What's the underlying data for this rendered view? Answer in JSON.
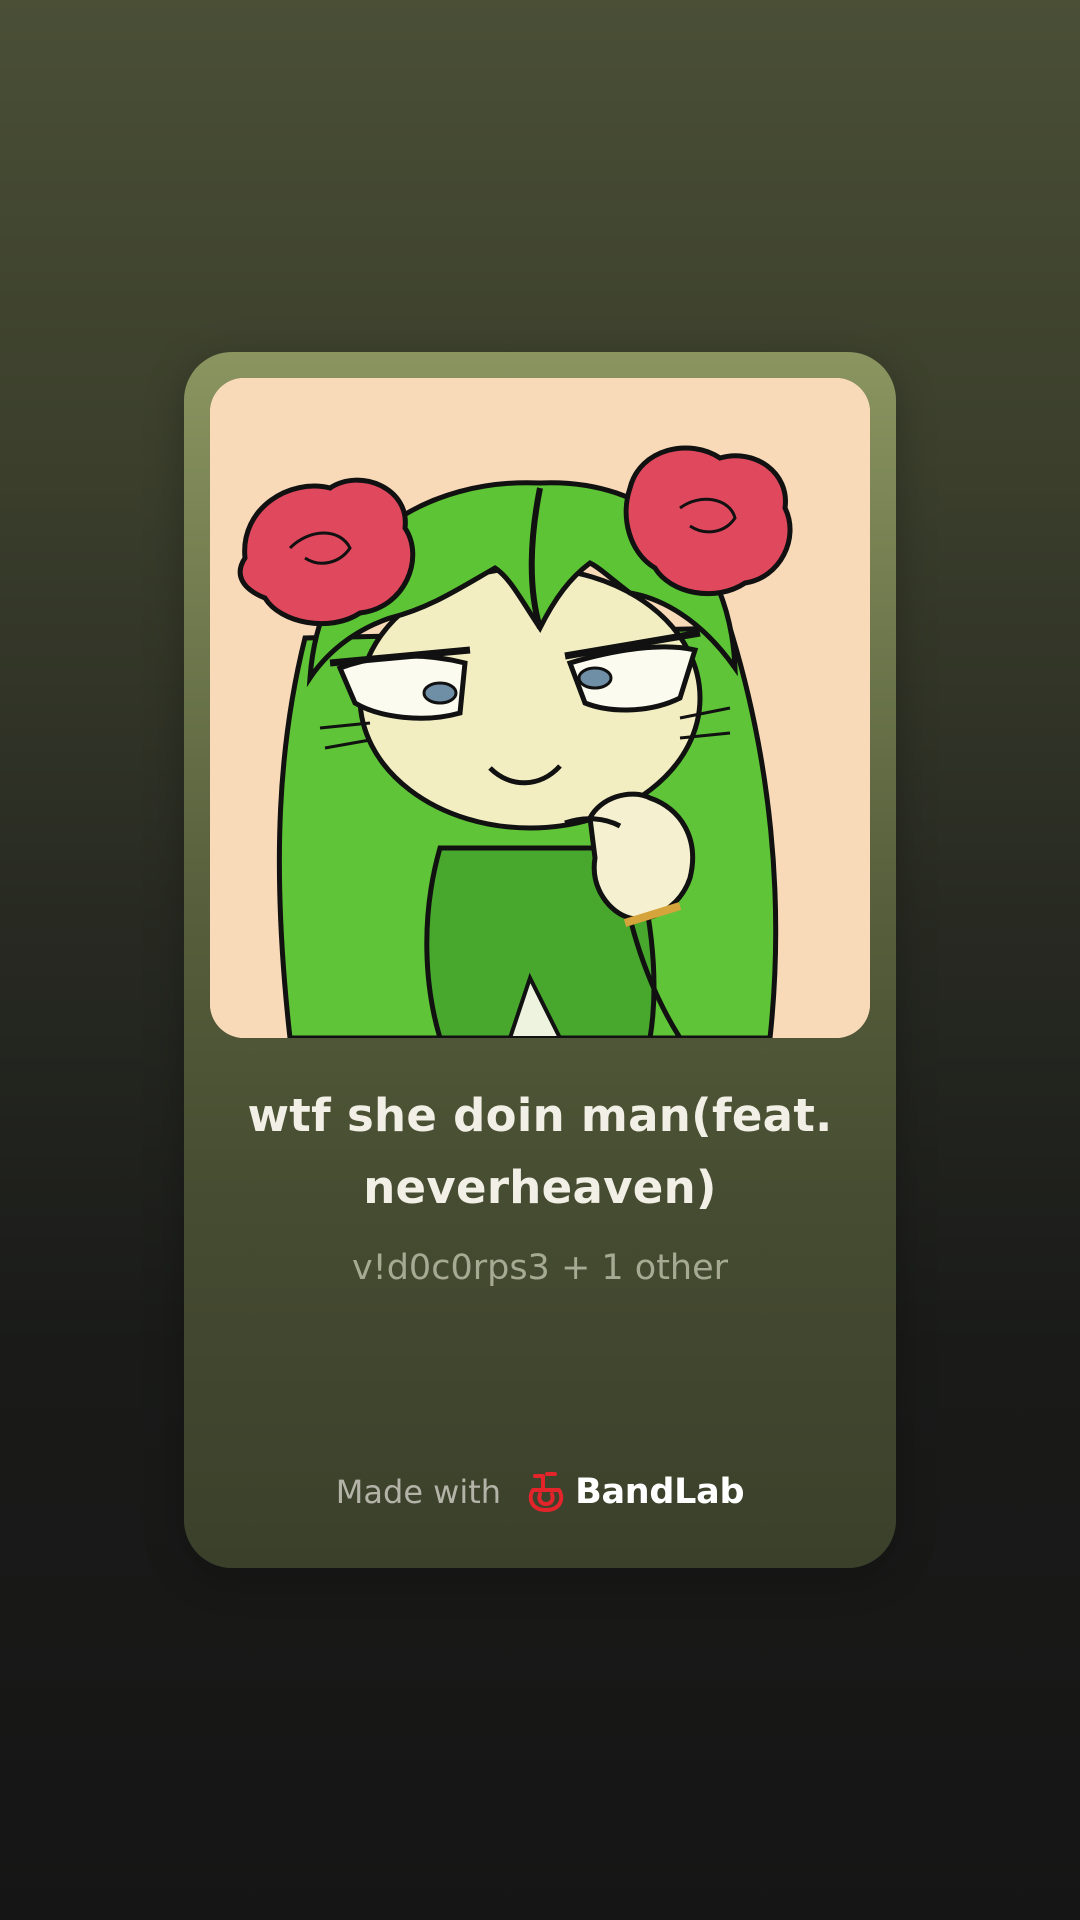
{
  "track": {
    "title": "wtf she doin man(feat. neverheaven)",
    "artists": "v!d0c0rps3 + 1 other"
  },
  "footer": {
    "made_with": "Made with",
    "brand": "BandLab",
    "brand_icon": "bandlab-logo-icon"
  },
  "colors": {
    "card_top": "#8a9560",
    "card_bottom": "#3b402b",
    "art_background": "#f7d8b6",
    "brand_red": "#e3242b"
  }
}
